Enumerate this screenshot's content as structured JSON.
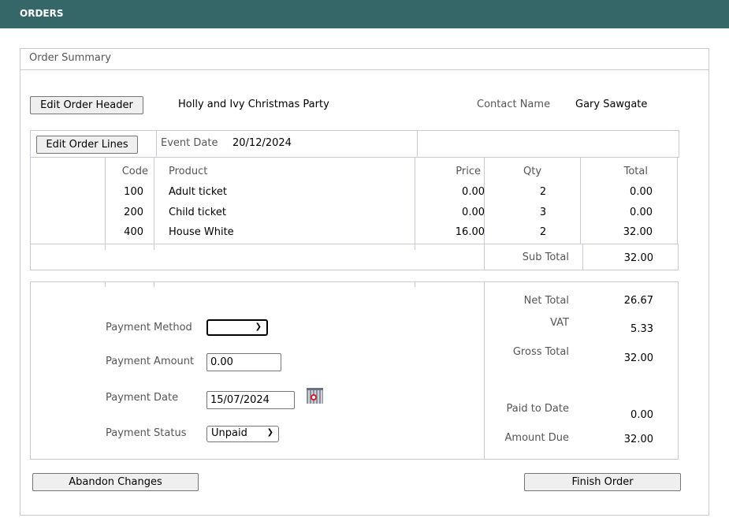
{
  "app": {
    "title": "ORDERS"
  },
  "panel": {
    "title": "Order Summary"
  },
  "header": {
    "edit_header_label": "Edit Order Header",
    "event_name": "Holly and Ivy Christmas Party",
    "contact_label": "Contact Name",
    "contact_value": "Gary Sawgate",
    "edit_lines_label": "Edit Order Lines",
    "event_date_label": "Event Date",
    "event_date_value": "20/12/2024"
  },
  "lines": {
    "columns": [
      "Code",
      "Product",
      "Price",
      "Qty",
      "Total"
    ],
    "rows": [
      {
        "code": "100",
        "product": "Adult ticket",
        "price": "0.00",
        "qty": "2",
        "total": "0.00"
      },
      {
        "code": "200",
        "product": "Child ticket",
        "price": "0.00",
        "qty": "3",
        "total": "0.00"
      },
      {
        "code": "400",
        "product": "House White",
        "price": "16.00",
        "qty": "2",
        "total": "32.00"
      }
    ],
    "subtotal_label": "Sub Total",
    "subtotal_value": "32.00"
  },
  "payment": {
    "method_label": "Payment Method",
    "method_value": "",
    "amount_label": "Payment Amount",
    "amount_value": "0.00",
    "date_label": "Payment Date",
    "date_value": "15/07/2024",
    "status_label": "Payment Status",
    "status_value": "Unpaid",
    "calendar_icon": "calendar-icon"
  },
  "totals": {
    "net_label": "Net Total",
    "net_value": "26.67",
    "vat_label": "VAT",
    "vat_value": "5.33",
    "gross_label": "Gross Total",
    "gross_value": "32.00",
    "paid_label": "Paid to Date",
    "paid_value": "0.00",
    "due_label": "Amount Due",
    "due_value": "32.00"
  },
  "actions": {
    "abandon_label": "Abandon Changes",
    "finish_label": "Finish Order"
  }
}
